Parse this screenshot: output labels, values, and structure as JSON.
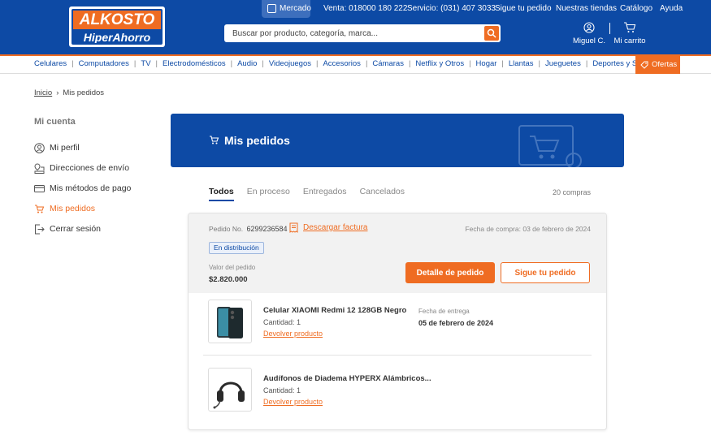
{
  "header": {
    "logo_top": "ALKOSTO",
    "logo_bottom": "HiperAhorro",
    "mercado_label": "Mercado",
    "top_links": [
      "Venta: 018000 180 222",
      "Servicio: (031) 407 3033",
      "Sigue tu pedido",
      "Nuestras tiendas",
      "Catálogo",
      "Ayuda"
    ],
    "search_placeholder": "Buscar por producto, categoría, marca...",
    "user_label": "Miguel C.",
    "cart_label": "Mi carrito"
  },
  "categories": [
    "Celulares",
    "Computadores",
    "TV",
    "Electrodomésticos",
    "Audio",
    "Videojuegos",
    "Accesorios",
    "Cámaras",
    "Netflix y Otros",
    "Hogar",
    "Llantas",
    "Jueguetes",
    "Deportes y Smartwatch"
  ],
  "ofertas_label": "Ofertas",
  "breadcrumb": {
    "home": "Inicio",
    "sep": "›",
    "current": "Mis pedidos"
  },
  "sidebar": {
    "title": "Mi cuenta",
    "items": [
      {
        "label": "Mi perfil",
        "icon": "user-icon"
      },
      {
        "label": "Direcciones de envío",
        "icon": "map-pin-icon"
      },
      {
        "label": "Mis métodos de pago",
        "icon": "credit-card-icon"
      },
      {
        "label": "Mis pedidos",
        "icon": "orders-icon",
        "active": true
      },
      {
        "label": "Cerrar sesión",
        "icon": "logout-icon"
      }
    ]
  },
  "banner": {
    "title": "Mis pedidos"
  },
  "tabs": [
    "Todos",
    "En proceso",
    "Entregados",
    "Cancelados"
  ],
  "order_count": "20 compras",
  "order": {
    "number_label": "Pedido No.",
    "number": "6299236584",
    "invoice_label": "Descargar factura",
    "purchase_date": "Fecha de compra: 03 de febrero de 2024",
    "status": "En distribución",
    "value_label": "Valor del pedido",
    "value": "$2.820.000",
    "detail_button": "Detalle de pedido",
    "track_button": "Sigue tu pedido",
    "products": [
      {
        "name": "Celular XIAOMI Redmi 12 128GB Negro",
        "qty": "Cantidad: 1",
        "return_label": "Devolver producto",
        "delivery_label": "Fecha de entrega",
        "delivery_date": "05 de febrero de 2024"
      },
      {
        "name": "Audífonos de Diadema HYPERX Alámbricos...",
        "qty": "Cantidad: 1",
        "return_label": "Devolver producto"
      }
    ]
  },
  "colors": {
    "brand_blue": "#0d4aa5",
    "accent_orange": "#ef6c22"
  }
}
